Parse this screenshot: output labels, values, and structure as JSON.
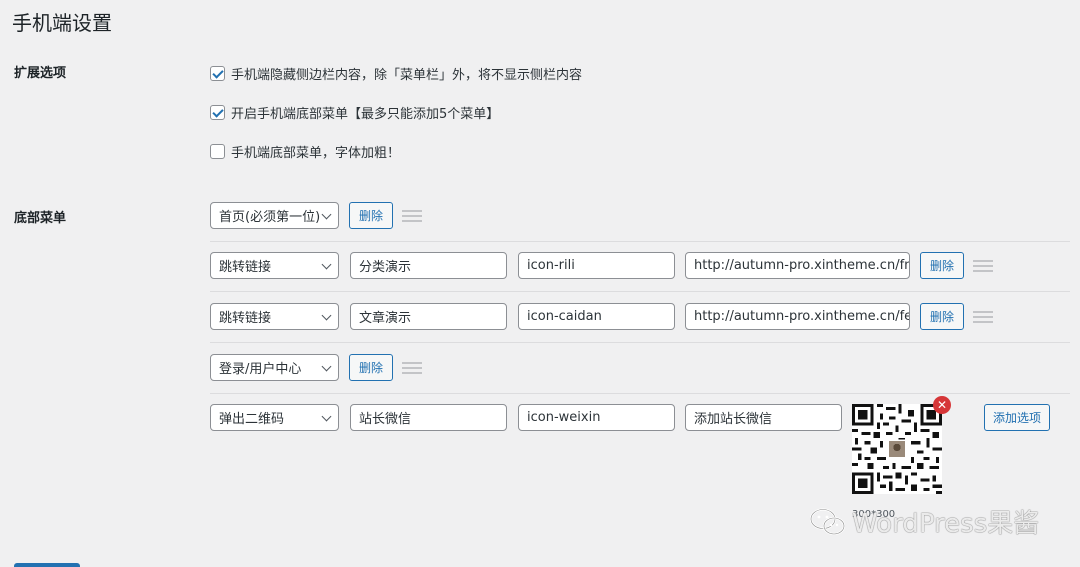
{
  "page": {
    "title": "手机端设置"
  },
  "extend": {
    "label": "扩展选项",
    "options": [
      {
        "label": "手机端隐藏侧边栏内容，除「菜单栏」外，将不显示侧栏内容",
        "checked": true
      },
      {
        "label": "开启手机端底部菜单【最多只能添加5个菜单】",
        "checked": true
      },
      {
        "label": "手机端底部菜单，字体加粗！",
        "checked": false
      }
    ]
  },
  "bottom_menu": {
    "label": "底部菜单",
    "delete_label": "删除",
    "add_label": "添加选项",
    "rows": [
      {
        "type": "首页(必须第一位)"
      },
      {
        "type": "跳转链接",
        "name": "分类演示",
        "icon": "icon-rili",
        "url": "http://autumn-pro.xintheme.cn/fnlei-"
      },
      {
        "type": "跳转链接",
        "name": "文章演示",
        "icon": "icon-caidan",
        "url": "http://autumn-pro.xintheme.cn/fenle"
      },
      {
        "type": "登录/用户中心"
      },
      {
        "type": "弹出二维码",
        "name": "站长微信",
        "icon": "icon-weixin",
        "desc": "添加站长微信"
      }
    ],
    "qr_caption": "300*300"
  },
  "watermark": {
    "text": "WordPress果酱"
  },
  "colors": {
    "accent": "#2271b1",
    "danger": "#d63638",
    "background": "#f0f0f1"
  }
}
